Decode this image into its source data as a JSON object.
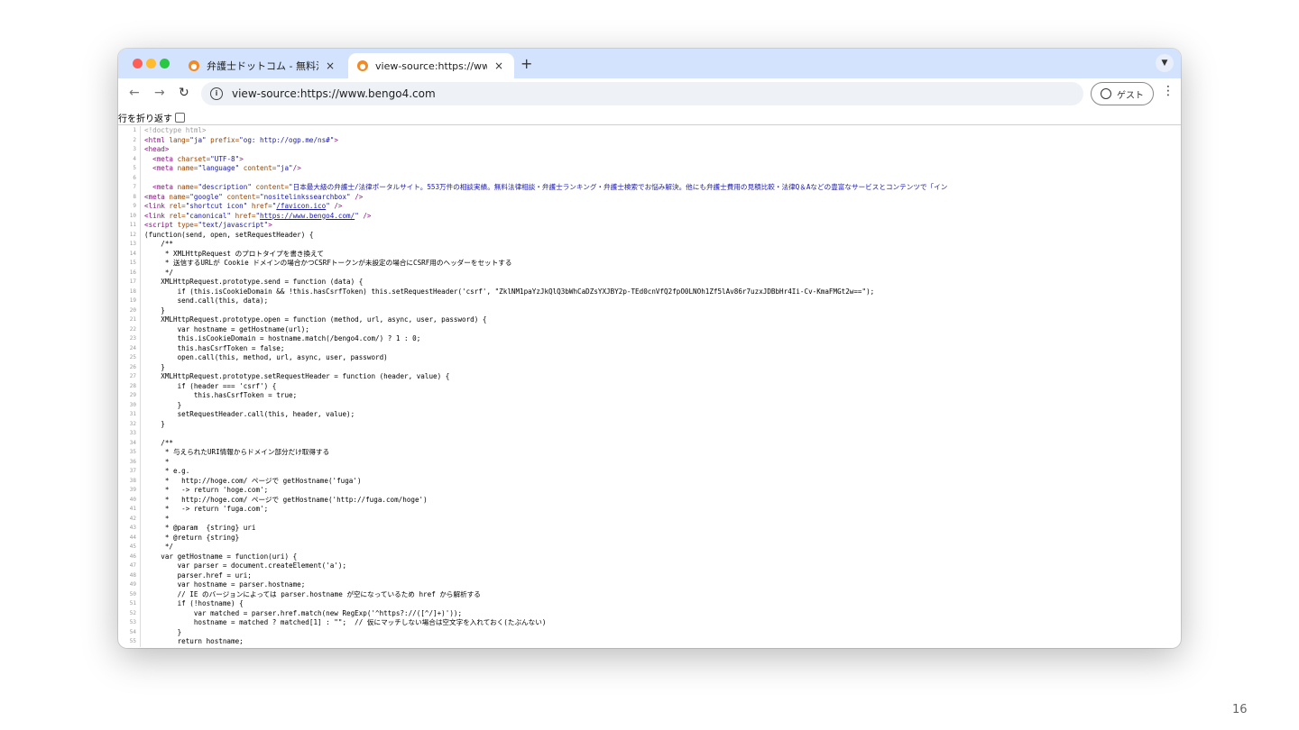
{
  "browser": {
    "tabs": [
      {
        "title": "弁護士ドットコム - 無料法律相談",
        "active": false
      },
      {
        "title": "view-source:https://www.ben",
        "active": true
      }
    ],
    "new_tab": "+",
    "url": "view-source:https://www.bengo4.com",
    "profile_label": "ゲスト"
  },
  "source": {
    "wrap_label": "行を折り返す",
    "lines": [
      "1",
      "2",
      "3",
      "4",
      "5",
      "6",
      "7",
      "8",
      "9",
      "10",
      "11",
      "12",
      "13",
      "14",
      "15",
      "16",
      "17",
      "18",
      "19",
      "20",
      "21",
      "22",
      "23",
      "24",
      "25",
      "26",
      "27",
      "28",
      "29",
      "30",
      "31",
      "32",
      "33",
      "34",
      "35",
      "36",
      "37",
      "38",
      "39",
      "40",
      "41",
      "42",
      "43",
      "44",
      "45",
      "46",
      "47",
      "48",
      "49",
      "50",
      "51",
      "52",
      "53",
      "54",
      "55"
    ],
    "code": {
      "l1": "<!doctype html>",
      "l2a": "<html",
      "l2b": " lang=",
      "l2c": "\"ja\"",
      "l2d": " prefix=",
      "l2e": "\"og: http://ogp.me/ns#\"",
      "l2f": ">",
      "l3": "<head>",
      "l4a": "  <meta",
      "l4b": " charset=",
      "l4c": "\"UTF-8\"",
      "l4d": ">",
      "l5a": "  <meta",
      "l5b": " name=",
      "l5c": "\"language\"",
      "l5d": " content=",
      "l5e": "\"ja\"",
      "l5f": "/>",
      "l7a": "  <meta",
      "l7b": " name=",
      "l7c": "\"description\"",
      "l7d": " content=",
      "l7e": "\"日本最大級の弁護士/法律ポータルサイト。553万件の相談実績。無料法律相談・弁護士ランキング・弁護士検索でお悩み解決。他にも弁護士費用の見積比較・法律Q＆Aなどの豊富なサービスとコンテンツで「イン",
      "l8a": "<meta",
      "l8b": " name=",
      "l8c": "\"google\"",
      "l8d": " content=",
      "l8e": "\"nositelinkssearchbox\"",
      "l8f": " />",
      "l9a": "<link",
      "l9b": " rel=",
      "l9c": "\"shortcut icon\"",
      "l9d": " href=",
      "l9e": "\"",
      "l9f": "/favicon.ico",
      "l9g": "\"",
      "l9h": " />",
      "l10a": "<link",
      "l10b": " rel=",
      "l10c": "\"canonical\"",
      "l10d": " href=",
      "l10e": "\"",
      "l10f": "https://www.bengo4.com/",
      "l10g": "\"",
      "l10h": " />",
      "l11a": "<script",
      "l11b": " type=",
      "l11c": "\"text/javascript\"",
      "l11d": ">",
      "l12": "(function(send, open, setRequestHeader) {",
      "l13": "    /**",
      "l14": "     * XMLHttpRequest のプロトタイプを書き換えて",
      "l15": "     * 送信するURLが Cookie ドメインの場合かつCSRFトークンが未設定の場合にCSRF用のヘッダーをセットする",
      "l16": "     */",
      "l17": "    XMLHttpRequest.prototype.send = function (data) {",
      "l18": "        if (this.isCookieDomain && !this.hasCsrfToken) this.setRequestHeader('csrf', \"ZklNM1paYzJkQlQ3bWhCaDZsYXJBY2p-TEd0cnVfQ2fpO0LNOh1Zf5lAv86r7uzxJDBbHr4Ii-Cv-KmaFMGt2w==\");",
      "l19": "        send.call(this, data);",
      "l20": "    }",
      "l21": "    XMLHttpRequest.prototype.open = function (method, url, async, user, password) {",
      "l22": "        var hostname = getHostname(url);",
      "l23": "        this.isCookieDomain = hostname.match(/bengo4.com/) ? 1 : 0;",
      "l24": "        this.hasCsrfToken = false;",
      "l25": "        open.call(this, method, url, async, user, password)",
      "l26": "    }",
      "l27": "    XMLHttpRequest.prototype.setRequestHeader = function (header, value) {",
      "l28": "        if (header === 'csrf') {",
      "l29": "            this.hasCsrfToken = true;",
      "l30": "        }",
      "l31": "        setRequestHeader.call(this, header, value);",
      "l32": "    }",
      "l34": "    /**",
      "l35": "     * 与えられたURI情報からドメイン部分だけ取得する",
      "l36": "     *",
      "l37": "     * e.g.",
      "l38": "     *   http://hoge.com/ ページで getHostname('fuga')",
      "l39": "     *   -> return 'hoge.com';",
      "l40": "     *   http://hoge.com/ ページで getHostname('http://fuga.com/hoge')",
      "l41": "     *   -> return 'fuga.com';",
      "l42": "     *",
      "l43": "     * @param  {string} uri",
      "l44": "     * @return {string}",
      "l45": "     */",
      "l46": "    var getHostname = function(uri) {",
      "l47": "        var parser = document.createElement('a');",
      "l48": "        parser.href = uri;",
      "l49": "        var hostname = parser.hostname;",
      "l50": "        // IE のバージョンによっては parser.hostname が空になっているため href から解析する",
      "l51": "        if (!hostname) {",
      "l52": "            var matched = parser.href.match(new RegExp('^https?://([^/]+)'));",
      "l53": "            hostname = matched ? matched[1] : \"\";  // 仮にマッチしない場合は空文字を入れておく(たぶんない)",
      "l54": "        }",
      "l55": "        return hostname;"
    }
  },
  "slide_page_number": "16"
}
